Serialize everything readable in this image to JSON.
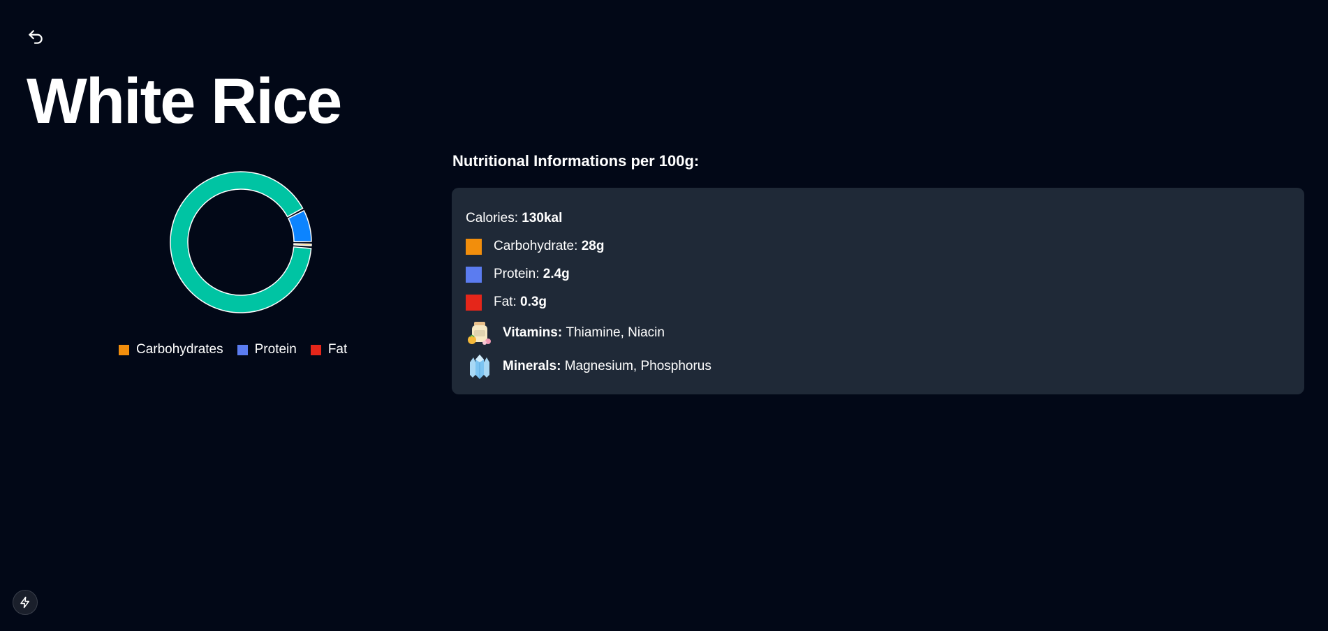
{
  "header": {
    "title": "White Rice"
  },
  "legend": {
    "items": [
      {
        "label": "Carbohydrates",
        "color": "#f28e0c"
      },
      {
        "label": "Protein",
        "color": "#5b7cf0"
      },
      {
        "label": "Fat",
        "color": "#e5261a"
      }
    ]
  },
  "chart_data": {
    "type": "pie",
    "title": "",
    "categories": [
      "Carbohydrates",
      "Protein",
      "Fat"
    ],
    "values": [
      28,
      2.4,
      0.3
    ],
    "unit": "g",
    "slice_colors": [
      "#00c4a3",
      "#0c84ff",
      "#fec748"
    ],
    "donut": true,
    "legend_position": "bottom"
  },
  "nutrition": {
    "heading": "Nutritional Informations per 100g:",
    "calories_label": "Calories:",
    "calories_value": "130kal",
    "carbohydrate_label": "Carbohydrate:",
    "carbohydrate_value": "28g",
    "carbohydrate_color": "#f28e0c",
    "protein_label": "Protein:",
    "protein_value": "2.4g",
    "protein_color": "#5b7cf0",
    "fat_label": "Fat:",
    "fat_value": "0.3g",
    "fat_color": "#e5261a",
    "vitamins_label": "Vitamins:",
    "vitamins_value": "Thiamine, Niacin",
    "vitamins_icon": "vitamins-bottle-icon",
    "minerals_label": "Minerals:",
    "minerals_value": "Magnesium, Phosphorus",
    "minerals_icon": "crystal-icon"
  },
  "icons": {
    "back": "undo-arrow-icon",
    "footer": "lightning-bolt-icon"
  },
  "colors": {
    "background": "#020817",
    "card": "#1f2937"
  }
}
